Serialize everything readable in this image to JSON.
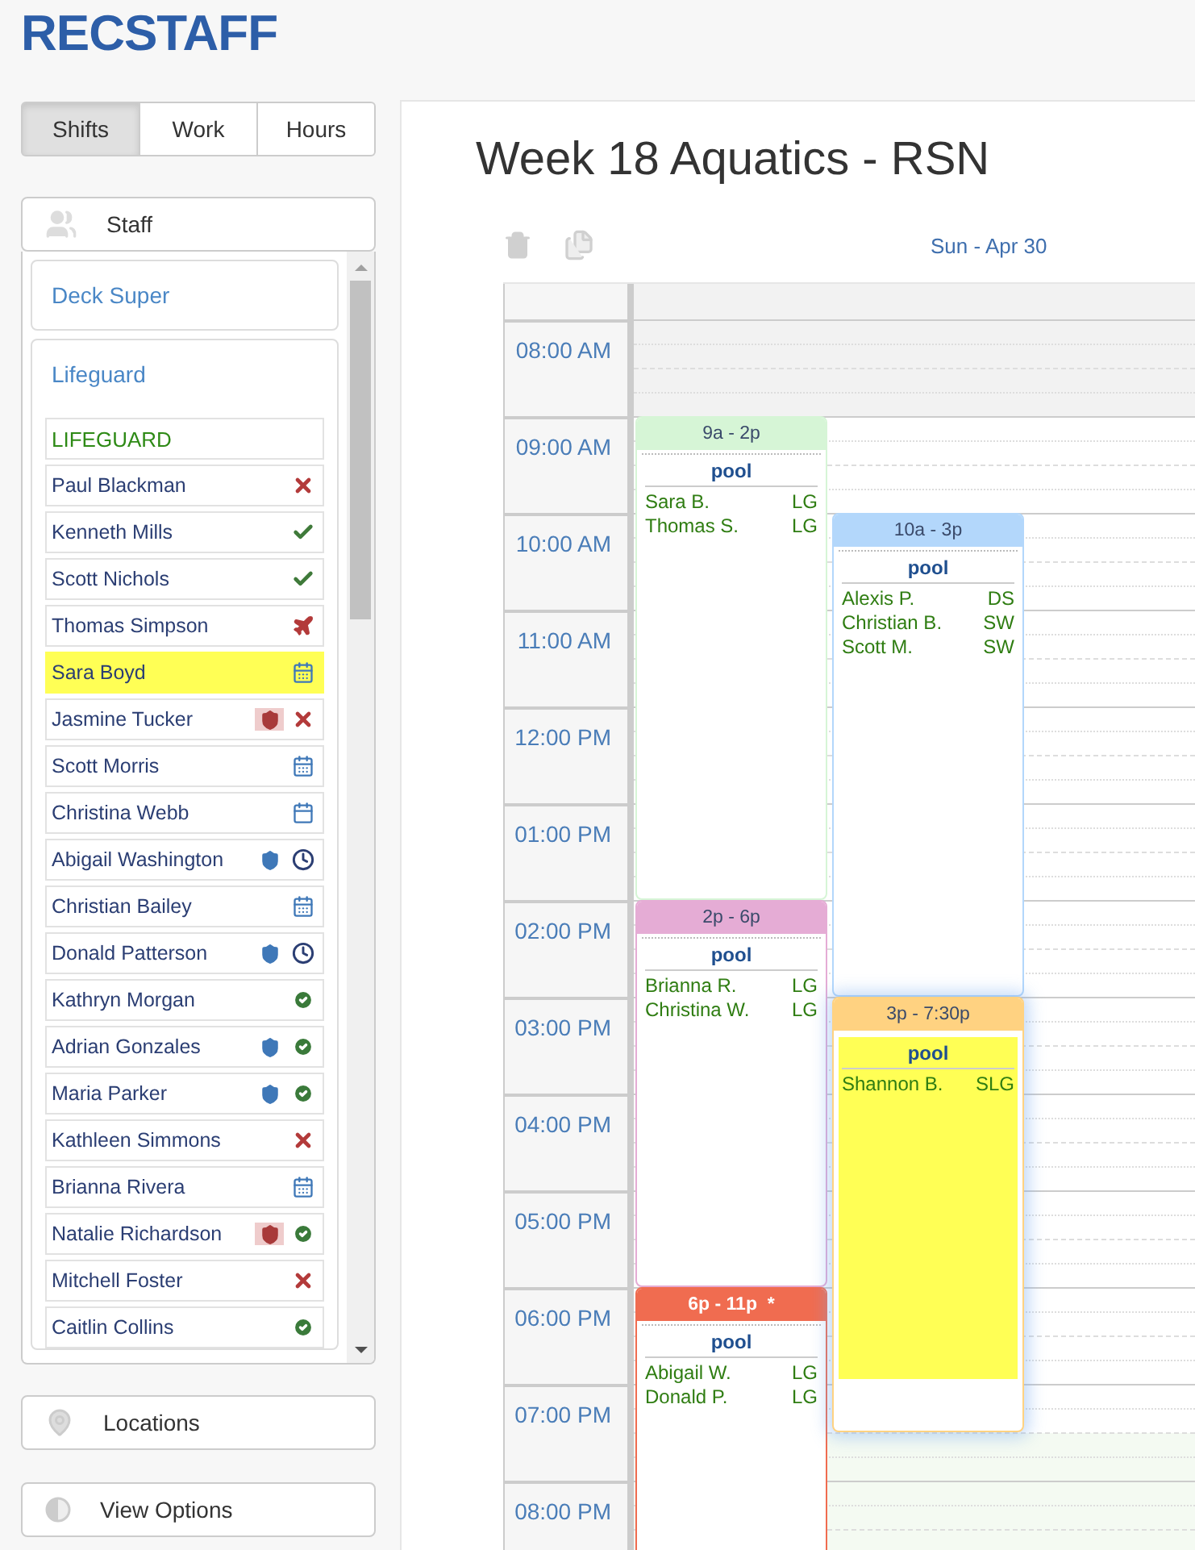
{
  "logo": "RECSTAFF",
  "view_tabs": [
    {
      "label": "Shifts",
      "selected": true
    },
    {
      "label": "Work",
      "selected": false
    },
    {
      "label": "Hours",
      "selected": false
    }
  ],
  "staff_panel": {
    "title": "Staff",
    "groups": [
      {
        "title": "Deck Super",
        "expanded": false
      },
      {
        "title": "Lifeguard",
        "expanded": true,
        "role_header": "LIFEGUARD",
        "members": [
          {
            "name": "Paul Blackman",
            "highlighted": false,
            "status": {
              "kind": "cross"
            }
          },
          {
            "name": "Kenneth Mills",
            "highlighted": false,
            "status": {
              "kind": "check"
            }
          },
          {
            "name": "Scott Nichols",
            "highlighted": false,
            "status": {
              "kind": "check"
            }
          },
          {
            "name": "Thomas Simpson",
            "highlighted": false,
            "status": {
              "kind": "plane"
            }
          },
          {
            "name": "Sara Boyd",
            "highlighted": true,
            "status": {
              "kind": "calendar"
            }
          },
          {
            "name": "Jasmine Tucker",
            "highlighted": false,
            "shield": {
              "color": "#a83a3a",
              "highlighted": true
            },
            "status": {
              "kind": "cross"
            }
          },
          {
            "name": "Scott Morris",
            "highlighted": false,
            "status": {
              "kind": "calendar"
            }
          },
          {
            "name": "Christina Webb",
            "highlighted": false,
            "status": {
              "kind": "blank-calendar"
            }
          },
          {
            "name": "Abigail Washington",
            "highlighted": false,
            "shield": {
              "color": "#3f78b8",
              "highlighted": false
            },
            "status": {
              "kind": "clock"
            }
          },
          {
            "name": "Christian Bailey",
            "highlighted": false,
            "status": {
              "kind": "calendar"
            }
          },
          {
            "name": "Donald Patterson",
            "highlighted": false,
            "shield": {
              "color": "#3f78b8",
              "highlighted": false
            },
            "status": {
              "kind": "clock"
            }
          },
          {
            "name": "Kathryn Morgan",
            "highlighted": false,
            "status": {
              "kind": "badge"
            }
          },
          {
            "name": "Adrian Gonzales",
            "highlighted": false,
            "shield": {
              "color": "#3f78b8",
              "highlighted": false
            },
            "status": {
              "kind": "badge"
            }
          },
          {
            "name": "Maria Parker",
            "highlighted": false,
            "shield": {
              "color": "#3f78b8",
              "highlighted": false
            },
            "status": {
              "kind": "badge"
            }
          },
          {
            "name": "Kathleen Simmons",
            "highlighted": false,
            "status": {
              "kind": "cross"
            }
          },
          {
            "name": "Brianna Rivera",
            "highlighted": false,
            "status": {
              "kind": "calendar"
            }
          },
          {
            "name": "Natalie Richardson",
            "highlighted": false,
            "shield": {
              "color": "#a83a3a",
              "highlighted": true
            },
            "status": {
              "kind": "badge"
            }
          },
          {
            "name": "Mitchell Foster",
            "highlighted": false,
            "status": {
              "kind": "cross"
            }
          },
          {
            "name": "Caitlin Collins",
            "highlighted": false,
            "status": {
              "kind": "badge"
            }
          }
        ]
      }
    ]
  },
  "other_panels": [
    {
      "title": "Locations",
      "kind": "pin"
    },
    {
      "title": "View Options",
      "kind": "contrast"
    }
  ],
  "title": "Week 18 Aquatics - RSN",
  "toolbar": [
    {
      "kind": "delete",
      "disabled": true
    },
    {
      "kind": "copy",
      "disabled": true
    }
  ],
  "day": "Sun - Apr 30",
  "hours": [
    {
      "label": "08:00 AM",
      "kind": "closed"
    },
    {
      "label": "09:00 AM",
      "kind": "open"
    },
    {
      "label": "10:00 AM",
      "kind": "open"
    },
    {
      "label": "11:00 AM",
      "kind": "open"
    },
    {
      "label": "12:00 PM",
      "kind": "open"
    },
    {
      "label": "01:00 PM",
      "kind": "open"
    },
    {
      "label": "02:00 PM",
      "kind": "open"
    },
    {
      "label": "03:00 PM",
      "kind": "open"
    },
    {
      "label": "04:00 PM",
      "kind": "open"
    },
    {
      "label": "05:00 PM",
      "kind": "open"
    },
    {
      "label": "06:00 PM",
      "kind": "open"
    },
    {
      "label": "07:00 PM",
      "kind": "closing"
    },
    {
      "label": "08:00 PM",
      "kind": "closed-late"
    }
  ],
  "events": [
    {
      "time": "9a - 2p",
      "color": "#d6f5d6",
      "highlighted": false,
      "location": "pool",
      "staff": [
        {
          "name": "Sara B.",
          "role": "LG"
        },
        {
          "name": "Thomas S.",
          "role": "LG"
        }
      ]
    },
    {
      "time": "10a - 3p",
      "color": "#b3d7fb",
      "highlighted": false,
      "location": "pool",
      "staff": [
        {
          "name": "Alexis P.",
          "role": "DS"
        },
        {
          "name": "Christian B.",
          "role": "SW"
        },
        {
          "name": "Scott M.",
          "role": "SW"
        }
      ]
    },
    {
      "time": "2p - 6p",
      "color": "#e5acd5",
      "highlighted": false,
      "location": "pool",
      "staff": [
        {
          "name": "Brianna R.",
          "role": "LG"
        },
        {
          "name": "Christina W.",
          "role": "LG"
        }
      ]
    },
    {
      "time": "3p - 7:30p",
      "color": "#ffd281",
      "highlighted": true,
      "location": "pool",
      "staff": [
        {
          "name": "Shannon B.",
          "role": "SLG"
        }
      ]
    },
    {
      "time": "6p - 11p  *",
      "color": "#f06c50",
      "highlighted": false,
      "location": "pool",
      "staff": [
        {
          "name": "Abigail W.",
          "role": "LG"
        },
        {
          "name": "Donald P.",
          "role": "LG"
        }
      ]
    }
  ]
}
